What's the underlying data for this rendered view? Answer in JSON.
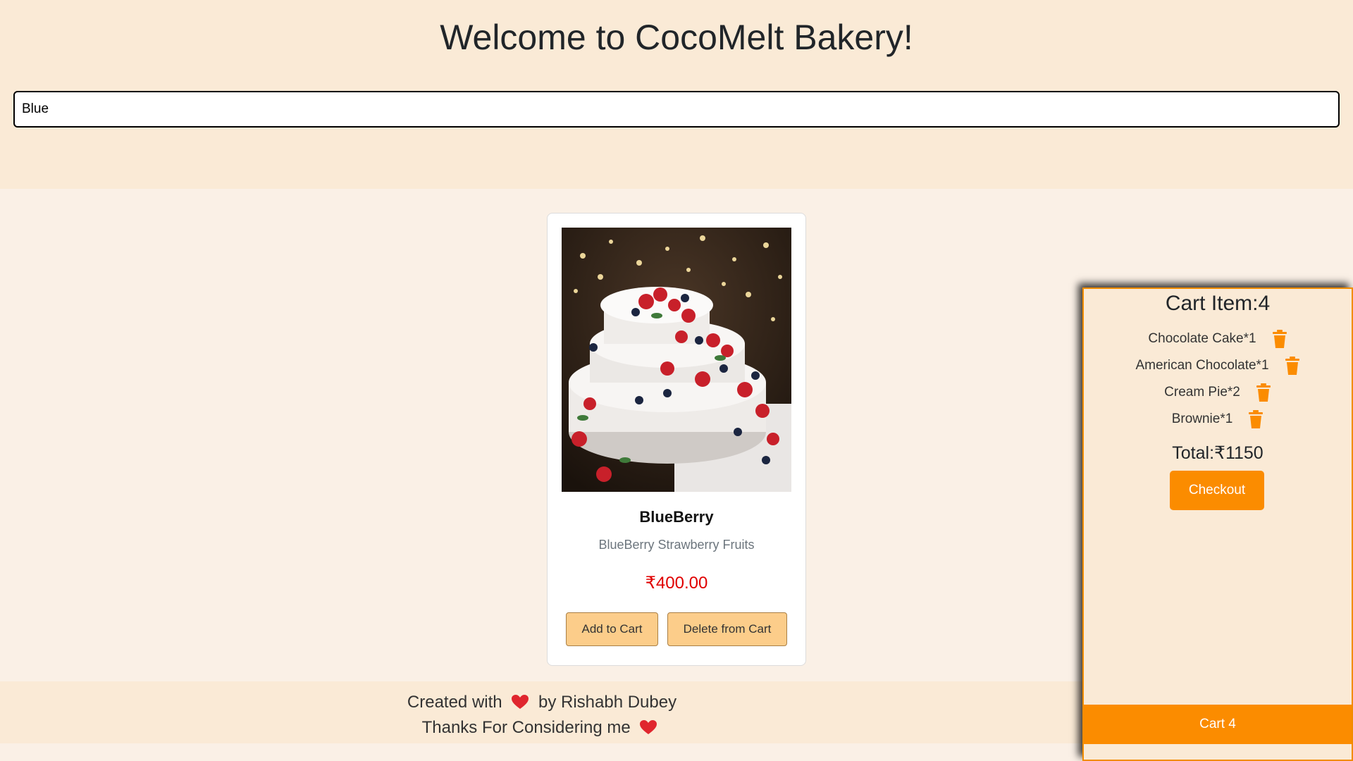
{
  "header": {
    "title": "Welcome to CocoMelt Bakery!",
    "search_value": "Blue"
  },
  "product": {
    "name": "BlueBerry",
    "description": "BlueBerry Strawberry Fruits",
    "price": "₹400.00",
    "add_label": "Add to Cart",
    "delete_label": "Delete from Cart",
    "image_icon": "cake-photo"
  },
  "footer": {
    "line1_prefix": "Created with",
    "line1_suffix": "by Rishabh Dubey",
    "line2_prefix": "Thanks For Considering me",
    "heart_icon": "heart-icon"
  },
  "cart": {
    "title": "Cart Item:4",
    "items": [
      {
        "label": "Chocolate Cake*1"
      },
      {
        "label": "American Chocolate*1"
      },
      {
        "label": "Cream Pie*2"
      },
      {
        "label": "Brownie*1"
      }
    ],
    "total": "Total:₹1150",
    "checkout_label": "Checkout",
    "cart_button_label": "Cart 4",
    "remove_icon": "trash-icon"
  },
  "colors": {
    "header_bg": "#faead6",
    "page_bg": "#faf0e6",
    "accent": "#fb8c00",
    "card_button": "#fccd8a",
    "price": "#e00000"
  }
}
